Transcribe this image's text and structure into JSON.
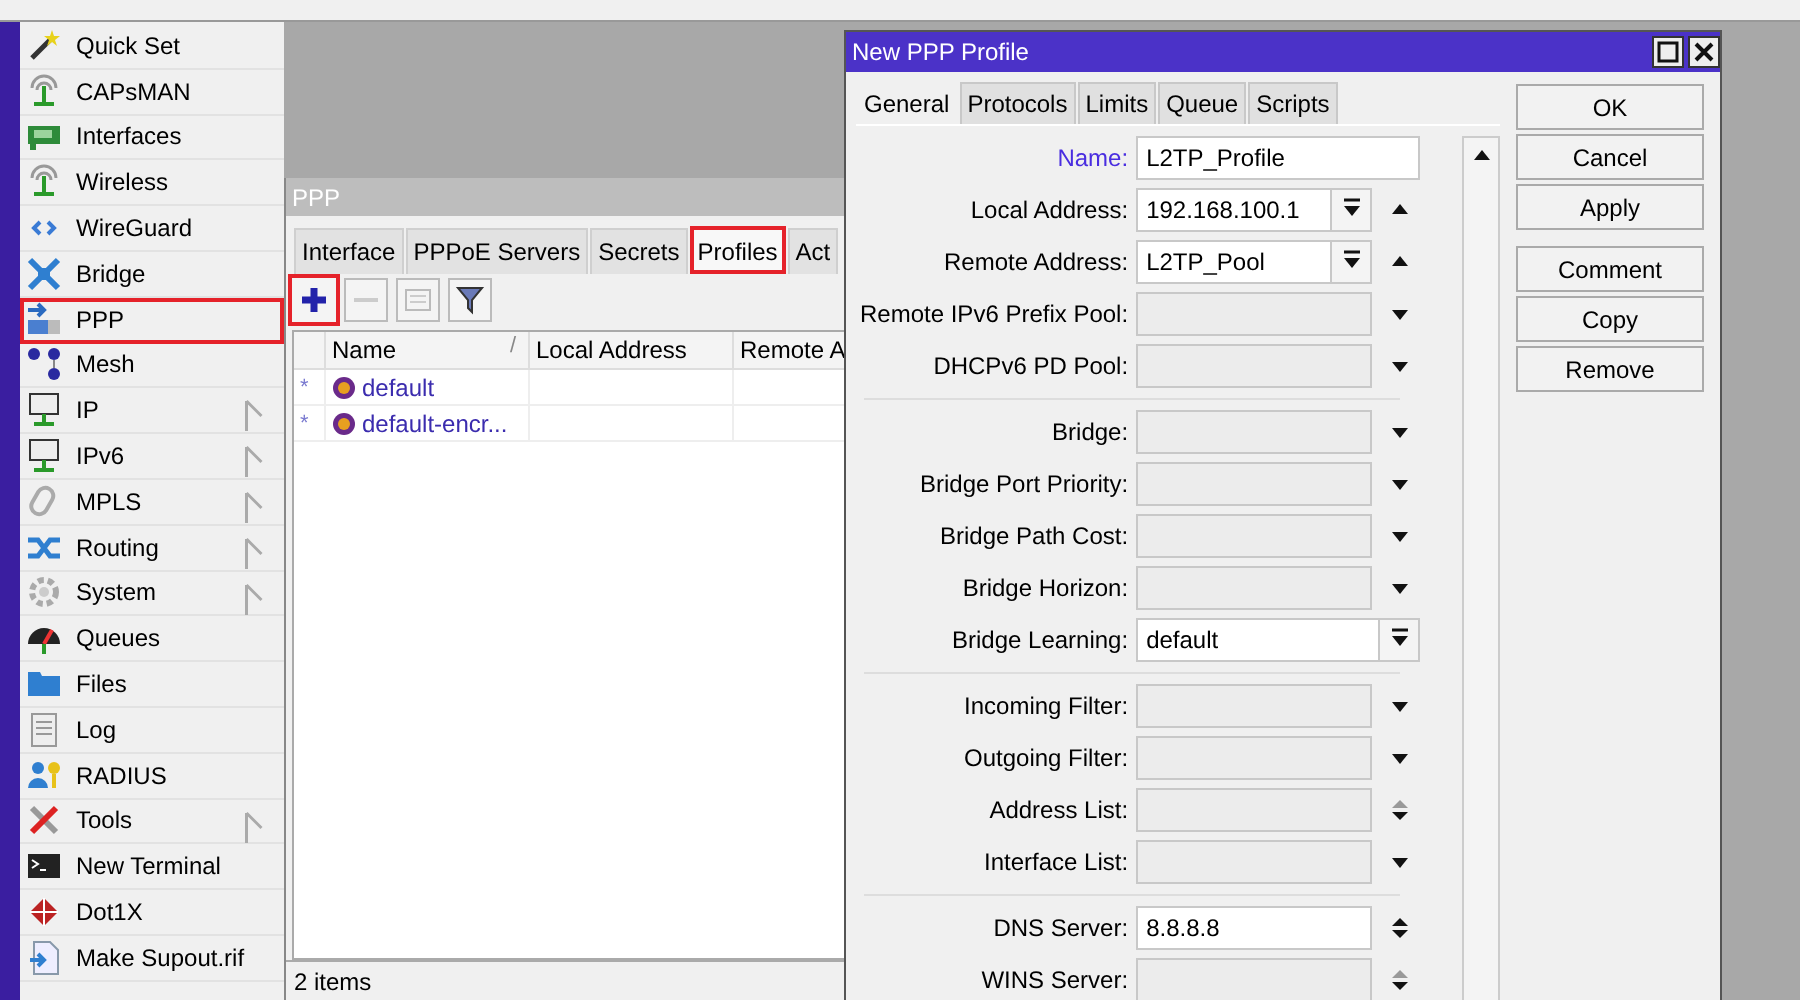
{
  "sidebar": {
    "items": [
      {
        "label": "Quick Set",
        "submenu": false,
        "highlighted": false
      },
      {
        "label": "CAPsMAN",
        "submenu": false,
        "highlighted": false
      },
      {
        "label": "Interfaces",
        "submenu": false,
        "highlighted": false
      },
      {
        "label": "Wireless",
        "submenu": false,
        "highlighted": false
      },
      {
        "label": "WireGuard",
        "submenu": false,
        "highlighted": false
      },
      {
        "label": "Bridge",
        "submenu": false,
        "highlighted": false
      },
      {
        "label": "PPP",
        "submenu": false,
        "highlighted": true
      },
      {
        "label": "Mesh",
        "submenu": false,
        "highlighted": false
      },
      {
        "label": "IP",
        "submenu": true,
        "highlighted": false
      },
      {
        "label": "IPv6",
        "submenu": true,
        "highlighted": false
      },
      {
        "label": "MPLS",
        "submenu": true,
        "highlighted": false
      },
      {
        "label": "Routing",
        "submenu": true,
        "highlighted": false
      },
      {
        "label": "System",
        "submenu": true,
        "highlighted": false
      },
      {
        "label": "Queues",
        "submenu": false,
        "highlighted": false
      },
      {
        "label": "Files",
        "submenu": false,
        "highlighted": false
      },
      {
        "label": "Log",
        "submenu": false,
        "highlighted": false
      },
      {
        "label": "RADIUS",
        "submenu": false,
        "highlighted": false
      },
      {
        "label": "Tools",
        "submenu": true,
        "highlighted": false
      },
      {
        "label": "New Terminal",
        "submenu": false,
        "highlighted": false
      },
      {
        "label": "Dot1X",
        "submenu": false,
        "highlighted": false
      },
      {
        "label": "Make Supout.rif",
        "submenu": false,
        "highlighted": false
      }
    ]
  },
  "ppp_window": {
    "title": "PPP",
    "tabs": [
      {
        "label": "Interface",
        "selected": false,
        "highlighted": false
      },
      {
        "label": "PPPoE Servers",
        "selected": false,
        "highlighted": false
      },
      {
        "label": "Secrets",
        "selected": false,
        "highlighted": false
      },
      {
        "label": "Profiles",
        "selected": true,
        "highlighted": true
      },
      {
        "label": "Act",
        "selected": false,
        "highlighted": false
      }
    ],
    "toolbar": [
      {
        "kind": "add",
        "disabled": false,
        "highlighted": true
      },
      {
        "kind": "remove",
        "disabled": true,
        "highlighted": false
      },
      {
        "kind": "comment",
        "disabled": true,
        "highlighted": false
      },
      {
        "kind": "filter",
        "disabled": false,
        "highlighted": false
      }
    ],
    "table": {
      "columns": [
        {
          "label": "Name",
          "sort_mark": "/"
        },
        {
          "label": "Local Address"
        },
        {
          "label": "Remote A"
        }
      ],
      "rows": [
        {
          "flag": "*",
          "name": "default"
        },
        {
          "flag": "*",
          "name": "default-encr..."
        }
      ]
    },
    "status_bar": "2 items"
  },
  "dialog": {
    "title": "New PPP Profile",
    "tabs": [
      {
        "label": "General",
        "selected": true
      },
      {
        "label": "Protocols",
        "selected": false
      },
      {
        "label": "Limits",
        "selected": false
      },
      {
        "label": "Queue",
        "selected": false
      },
      {
        "label": "Scripts",
        "selected": false
      }
    ],
    "sections": [
      [
        {
          "label": "Name:",
          "value": "L2TP_Profile",
          "kind": "text",
          "accent": true,
          "up": false,
          "down": false
        },
        {
          "label": "Local Address:",
          "value": "192.168.100.1",
          "kind": "combo",
          "accent": false,
          "up": true,
          "down": false,
          "up_disabled": false
        },
        {
          "label": "Remote Address:",
          "value": "L2TP_Pool",
          "kind": "combo",
          "accent": false,
          "up": true,
          "down": false,
          "up_disabled": false
        },
        {
          "label": "Remote IPv6 Prefix Pool:",
          "kind": "unset",
          "accent": false,
          "up": false,
          "down": true
        },
        {
          "label": "DHCPv6 PD Pool:",
          "kind": "unset",
          "accent": false,
          "up": false,
          "down": true
        }
      ],
      [
        {
          "label": "Bridge:",
          "kind": "unset",
          "accent": false,
          "up": false,
          "down": true
        },
        {
          "label": "Bridge Port Priority:",
          "kind": "unset",
          "accent": false,
          "up": false,
          "down": true
        },
        {
          "label": "Bridge Path Cost:",
          "kind": "unset",
          "accent": false,
          "up": false,
          "down": true
        },
        {
          "label": "Bridge Horizon:",
          "kind": "unset",
          "accent": false,
          "up": false,
          "down": true
        },
        {
          "label": "Bridge Learning:",
          "value": "default",
          "kind": "combo",
          "accent": false,
          "up": false,
          "down": false
        }
      ],
      [
        {
          "label": "Incoming Filter:",
          "kind": "unset",
          "accent": false,
          "up": false,
          "down": true
        },
        {
          "label": "Outgoing Filter:",
          "kind": "unset",
          "accent": false,
          "up": false,
          "down": true
        },
        {
          "label": "Address List:",
          "kind": "unset",
          "accent": false,
          "up": true,
          "down": true,
          "up_disabled": true
        },
        {
          "label": "Interface List:",
          "kind": "unset",
          "accent": false,
          "up": false,
          "down": true
        }
      ],
      [
        {
          "label": "DNS Server:",
          "value": "8.8.8.8",
          "kind": "text",
          "accent": false,
          "up": true,
          "down": true,
          "up_disabled": false
        },
        {
          "label": "WINS Server:",
          "kind": "unset",
          "accent": false,
          "up": true,
          "down": true,
          "up_disabled": true
        }
      ]
    ],
    "button_groups": [
      [
        "OK",
        "Cancel",
        "Apply"
      ],
      [
        "Comment",
        "Copy",
        "Remove"
      ]
    ]
  }
}
